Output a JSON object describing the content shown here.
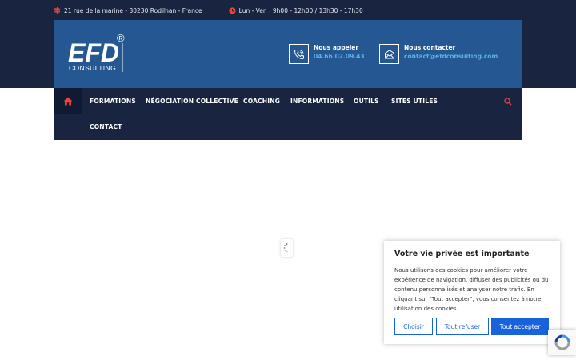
{
  "topbar": {
    "address": "21 rue de la marine - 30230 Rodilhan - France",
    "hours": "Lun - Ven : 9h00 - 12h00 / 13h30 - 17h30"
  },
  "header": {
    "logo_main": "EFD",
    "logo_sub": "CONSULTING",
    "logo_mark": "®",
    "call_label": "Nous appeler",
    "call_value": "04.66.02.09.43",
    "mail_label": "Nous contacter",
    "mail_value": "contact@efdconsulting.com"
  },
  "nav": {
    "items": [
      "FORMATIONS",
      "NÉGOCIATION COLLECTIVE",
      "COACHING",
      "INFORMATIONS",
      "OUTILS",
      "SITES UTILES",
      "CONTACT"
    ]
  },
  "cookie": {
    "title": "Votre vie privée est importante",
    "text": "Nous utilisons des cookies pour améliorer votre expérience de navigation, diffuser des publicités ou du contenu personnalisés et analyser notre trafic. En cliquant sur \"Tout accepter\", vous consentez à notre utilisation des cookies.",
    "choose": "Choisir",
    "reject": "Tout refuser",
    "accept": "Tout accepter"
  },
  "colors": {
    "dark_navy": "#192440",
    "header_blue": "#255892",
    "accent_red": "#e8443a",
    "link_blue": "#5ab0e6",
    "button_blue": "#1863dc"
  }
}
